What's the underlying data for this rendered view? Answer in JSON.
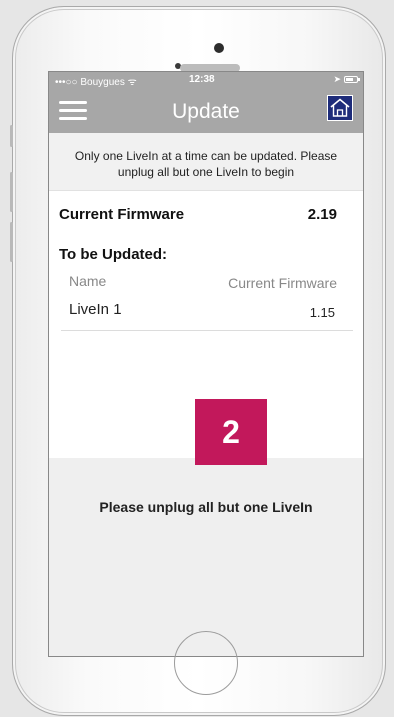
{
  "status_bar": {
    "carrier": "•••○○ Bouygues ᯤ",
    "time": "12:38",
    "location_icon": "location-arrow-icon",
    "battery_icon": "battery-icon"
  },
  "navbar": {
    "title": "Update",
    "menu_icon": "hamburger-menu-icon",
    "home_icon": "home-icon",
    "home_icon_bg": "#1e2c7a",
    "bar_color": "#a7a7a7"
  },
  "info_banner": {
    "text": "Only one LiveIn at a time can be updated. Please unplug all but one LiveIn to begin"
  },
  "current_firmware": {
    "label": "Current Firmware",
    "value": "2.19"
  },
  "to_be_updated": {
    "heading": "To be Updated:",
    "columns": [
      "Name",
      "Current Firmware"
    ],
    "rows": [
      {
        "name": "LiveIn 1",
        "firmware": "1.15"
      }
    ]
  },
  "step_badge": {
    "number": "2",
    "color": "#c2185b"
  },
  "bottom_message": "Please unplug all but one LiveIn"
}
